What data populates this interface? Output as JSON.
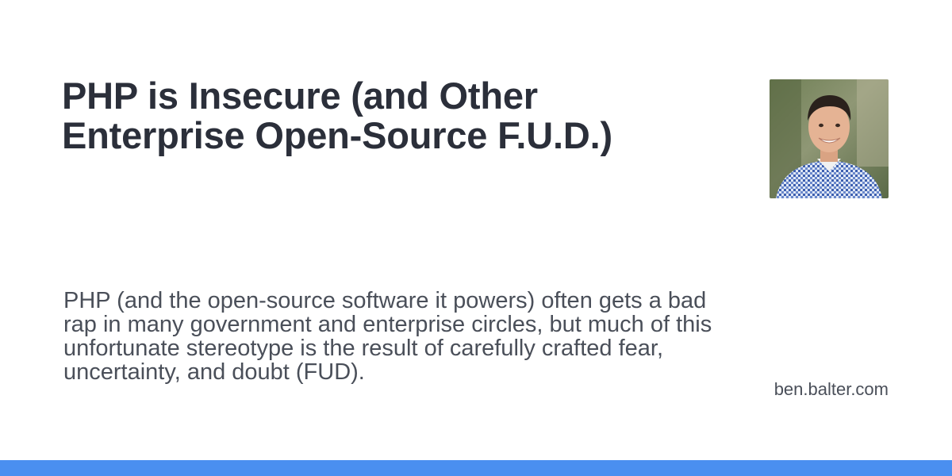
{
  "card": {
    "title": "PHP is Insecure (and Other Enterprise Open-Source F.U.D.)",
    "description": "PHP (and the open-source software it powers) often gets a bad rap in many government and enterprise circles, but much of this unfortunate stereotype is the result of carefully crafted fear, uncertainty, and doubt (FUD).",
    "site": "ben.balter.com",
    "avatar_icon": "author-photo"
  },
  "colors": {
    "background": "#ffffff",
    "title": "#2b2f3a",
    "text": "#4a4f59",
    "accent_bar": "#4a8ff0"
  }
}
